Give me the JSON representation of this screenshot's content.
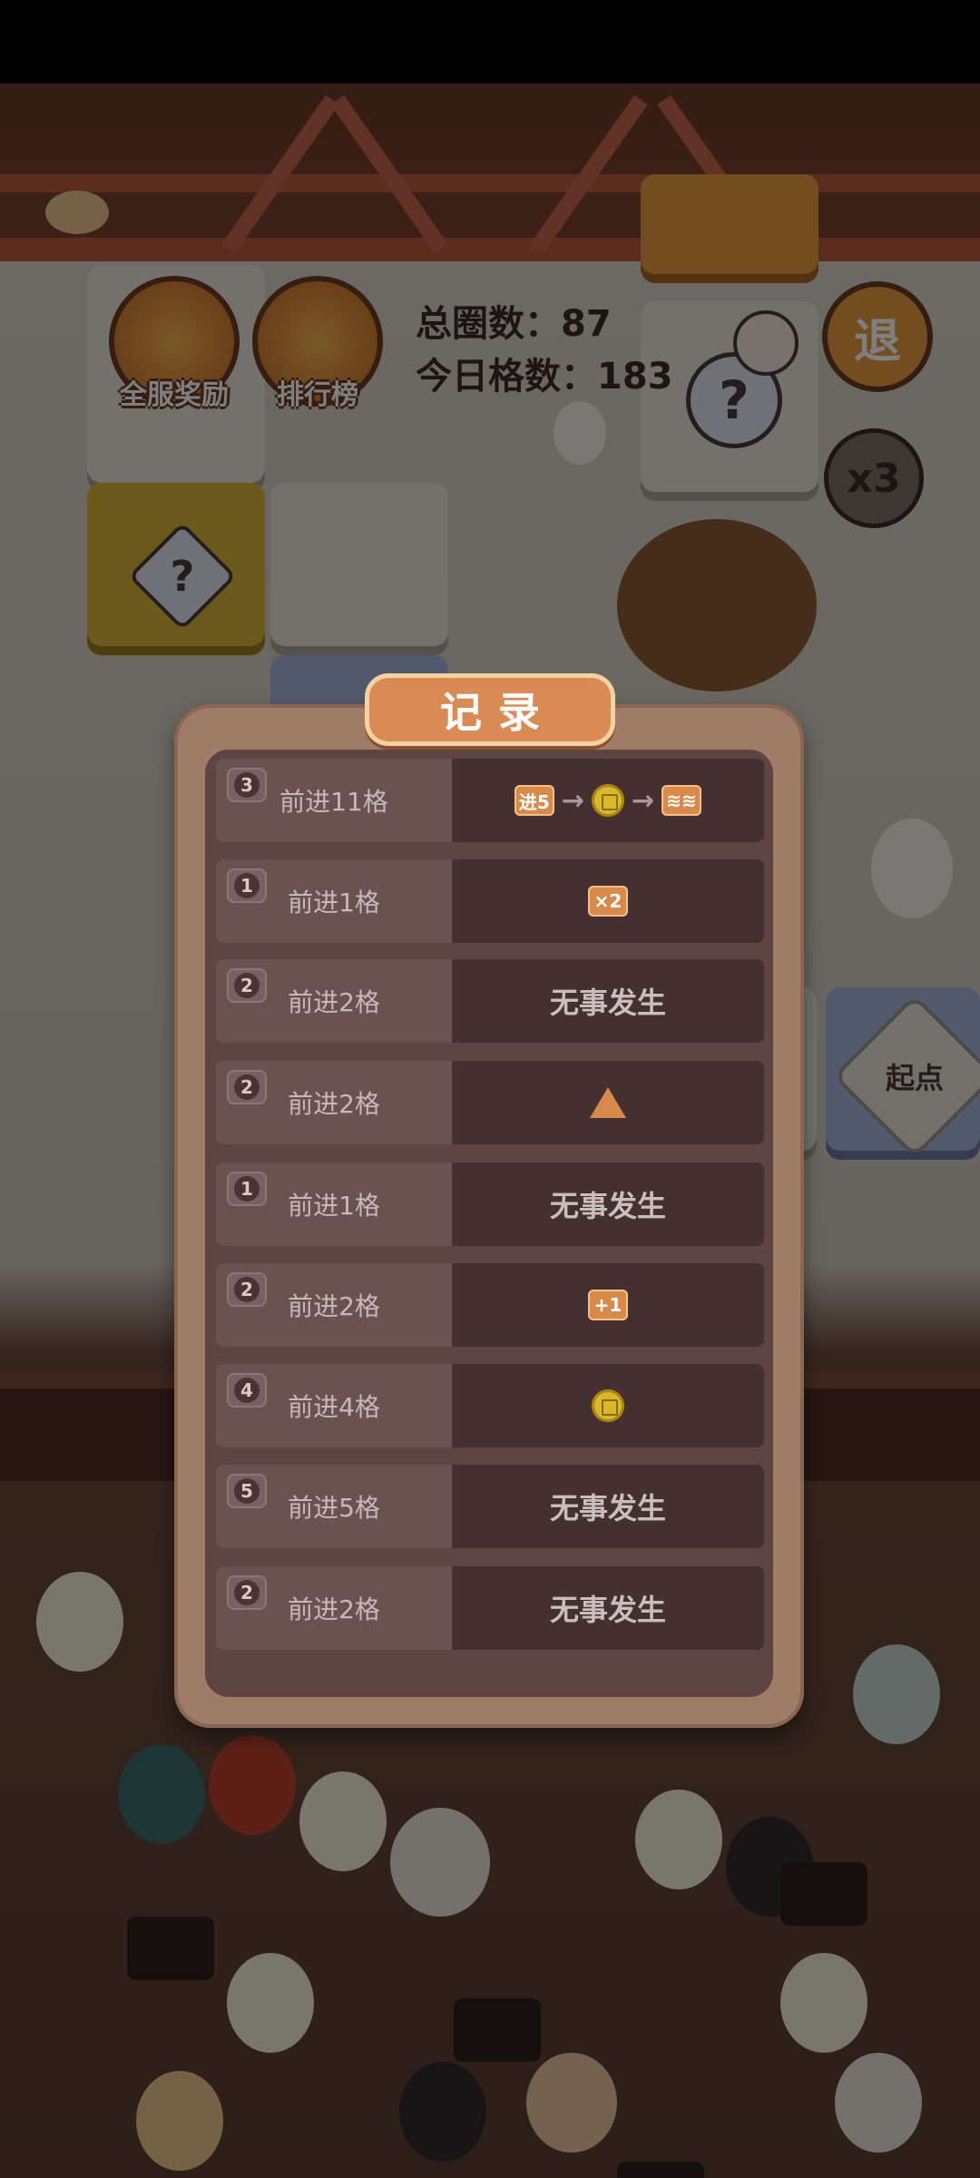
{
  "hud": {
    "total_laps_label": "总圈数：",
    "total_laps_value": "87",
    "today_cells_label": "今日格数：",
    "today_cells_value": "183",
    "server_reward_label": "全服奖励",
    "leaderboard_label": "排行榜",
    "exit_label": "退",
    "multiplier_label": "x3",
    "start_label": "起点",
    "mystery_label": "?"
  },
  "records": {
    "title": "记录",
    "rows": [
      {
        "dice": "3",
        "step": "前进11格",
        "result_type": "chain",
        "chain": {
          "tag1": "进5",
          "tag2": "≋≋"
        }
      },
      {
        "dice": "1",
        "step": "前进1格",
        "result_type": "tag",
        "tag": "×2"
      },
      {
        "dice": "2",
        "step": "前进2格",
        "result_type": "text",
        "text": "无事发生"
      },
      {
        "dice": "2",
        "step": "前进2格",
        "result_type": "warn"
      },
      {
        "dice": "1",
        "step": "前进1格",
        "result_type": "text",
        "text": "无事发生"
      },
      {
        "dice": "2",
        "step": "前进2格",
        "result_type": "tag",
        "tag": "+1"
      },
      {
        "dice": "4",
        "step": "前进4格",
        "result_type": "coin"
      },
      {
        "dice": "5",
        "step": "前进5格",
        "result_type": "text",
        "text": "无事发生"
      },
      {
        "dice": "2",
        "step": "前进2格",
        "result_type": "text",
        "text": "无事发生"
      }
    ]
  },
  "colors": {
    "overlay": "rgba(0,0,0,0.5)",
    "modal": "#a07c66",
    "title_plate": "#d98a55",
    "tag": "#d88a4a",
    "coin": "#d9b82a"
  }
}
